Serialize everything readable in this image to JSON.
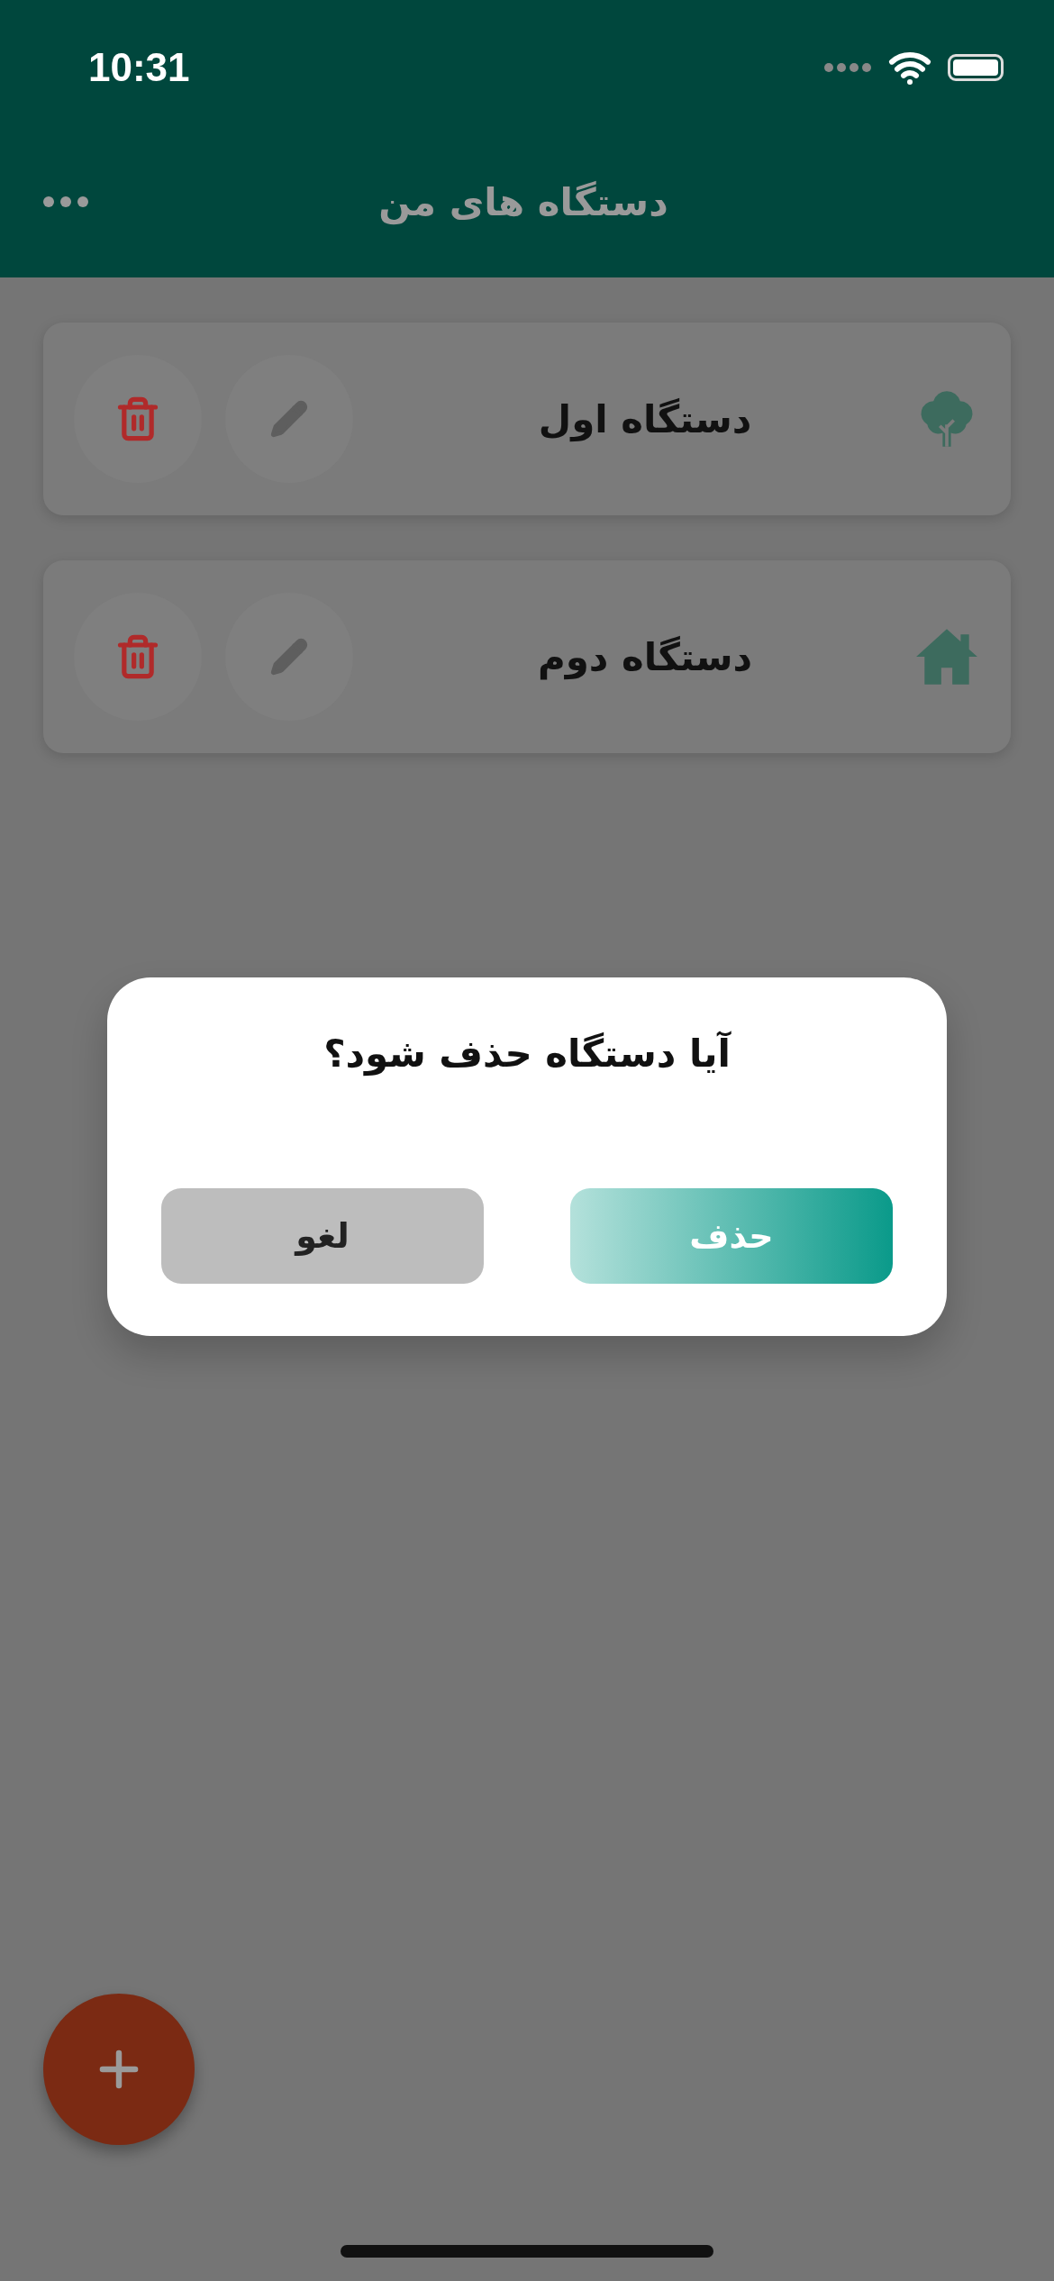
{
  "status_bar": {
    "time": "10:31"
  },
  "header": {
    "title": "دستگاه های من"
  },
  "devices": [
    {
      "name": "دستگاه اول",
      "kind": "tree"
    },
    {
      "name": "دستگاه دوم",
      "kind": "home"
    }
  ],
  "dialog": {
    "title": "آیا دستگاه حذف شود؟",
    "buttons": [
      {
        "label": "حذف",
        "kind": "primary"
      },
      {
        "label": "لغو",
        "kind": "secondary"
      }
    ]
  }
}
